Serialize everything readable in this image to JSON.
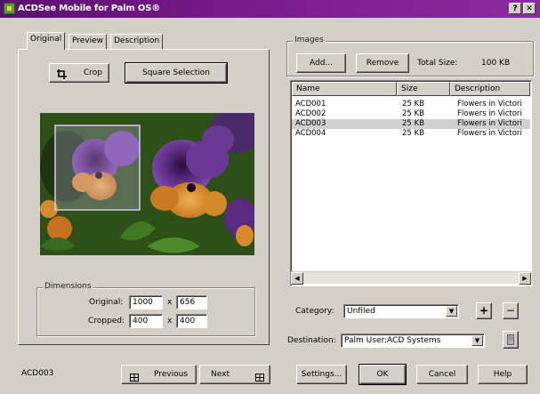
{
  "window": {
    "title": "ACDSee Mobile for Palm OS®",
    "help_button": "?",
    "close_button": "✕"
  },
  "tabs": [
    "Original",
    "Preview",
    "Description"
  ],
  "toolbar": {
    "crop_label": "Crop",
    "square_selection_label": "Square Selection"
  },
  "dimensions": {
    "legend": "Dimensions",
    "original_label": "Original:",
    "original_w": "1000",
    "original_h": "656",
    "cropped_label": "Cropped:",
    "cropped_w": "400",
    "cropped_h": "400",
    "x_sep": "x"
  },
  "images": {
    "legend": "Images",
    "add_label": "Add...",
    "remove_label": "Remove",
    "total_size_label": "Total Size:",
    "total_size_value": "100 KB",
    "columns": [
      "Name",
      "Size",
      "Description"
    ],
    "rows": [
      {
        "name": "ACD001",
        "size": "25 KB",
        "description": "Flowers in Victori"
      },
      {
        "name": "ACD002",
        "size": "25 KB",
        "description": "Flowers in Victori"
      },
      {
        "name": "ACD003",
        "size": "25 KB",
        "description": "Flowers in Victori"
      },
      {
        "name": "ACD004",
        "size": "25 KB",
        "description": "Flowers in Victori"
      }
    ]
  },
  "category": {
    "label": "Category:",
    "value": "Unfiled",
    "add_symbol": "+",
    "remove_symbol": "−"
  },
  "destination": {
    "label": "Destination:",
    "value": "Palm User:ACD Systems"
  },
  "footer": {
    "current_image": "ACD003",
    "previous_label": "Previous",
    "next_label": "Next",
    "settings_label": "Settings...",
    "ok_label": "OK",
    "cancel_label": "Cancel",
    "help_label": "Help"
  },
  "icons": {
    "crop": "crop-icon",
    "previous": "filmstrip-left-icon",
    "next": "filmstrip-right-icon",
    "destination_browse": "palm-device-icon"
  },
  "colors": {
    "titlebar": "#6a1580",
    "dialog_bg": "#d4d0c8",
    "selection_box": "#c8b8e8"
  }
}
